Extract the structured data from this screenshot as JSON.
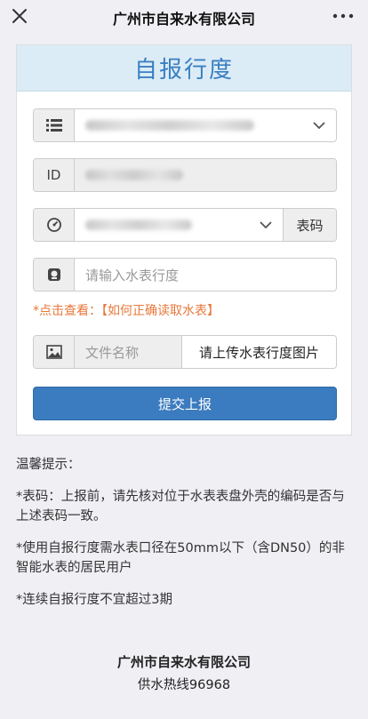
{
  "header": {
    "title": "广州市自来水有限公司"
  },
  "form": {
    "heading": "自报行度",
    "id_label": "ID",
    "meter_button": "表码",
    "reading_placeholder": "请输入水表行度",
    "hint_text": "*点击查看：【如何正确读取水表】",
    "file_placeholder": "文件名称",
    "upload_button": "请上传水表行度图片",
    "submit_button": "提交上报"
  },
  "notes": {
    "title": "温馨提示：",
    "items": [
      "*表码：上报前，请先核对位于水表表盘外壳的编码是否与上述表码一致。",
      "*使用自报行度需水表口径在50mm以下（含DN50）的非智能水表的居民用户",
      "*连续自报行度不宜超过3期"
    ]
  },
  "footer": {
    "company": "广州市自来水有限公司",
    "hotline": "供水热线96968"
  }
}
